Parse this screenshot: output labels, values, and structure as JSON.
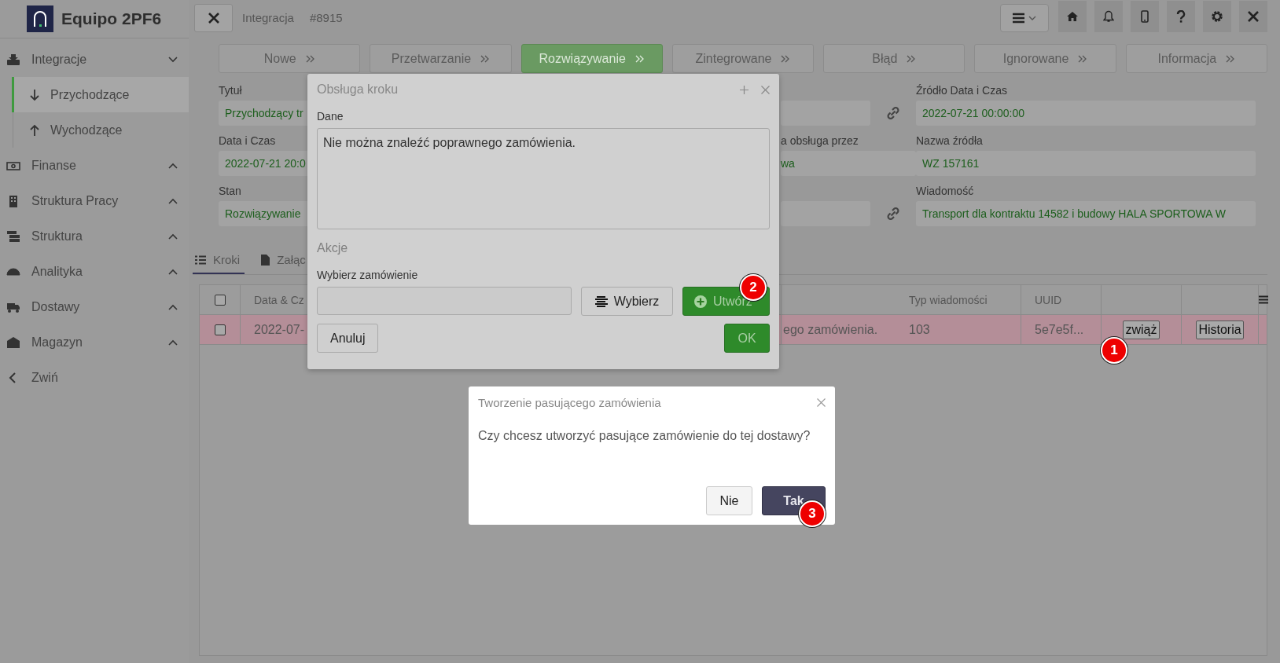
{
  "app": {
    "name": "Equipo 2PF6"
  },
  "sidebar": {
    "items": [
      {
        "label": "Integracje",
        "expanded": true,
        "children": [
          {
            "label": "Przychodzące",
            "selected": true
          },
          {
            "label": "Wychodzące",
            "selected": false
          }
        ]
      },
      {
        "label": "Finanse",
        "expanded": false
      },
      {
        "label": "Struktura Pracy",
        "expanded": false
      },
      {
        "label": "Struktura",
        "expanded": false
      },
      {
        "label": "Analityka",
        "expanded": false
      },
      {
        "label": "Dostawy",
        "expanded": false
      },
      {
        "label": "Magazyn",
        "expanded": false
      }
    ],
    "collapse": "Zwiń"
  },
  "topbar": {
    "title": "Integracja",
    "number": "#8915"
  },
  "status_steps": [
    {
      "label": "Nowe",
      "selected": false
    },
    {
      "label": "Przetwarzanie",
      "selected": false
    },
    {
      "label": "Rozwiązywanie",
      "selected": true
    },
    {
      "label": "Zintegrowane",
      "selected": false
    },
    {
      "label": "Błąd",
      "selected": false
    },
    {
      "label": "Ignorowane",
      "selected": false
    },
    {
      "label": "Informacja",
      "selected": false
    }
  ],
  "form": {
    "rows": [
      [
        {
          "label": "Tytuł",
          "value": "Przychodzący tr"
        },
        {},
        {
          "label": "Źródło Data i Czas",
          "value": "2022-07-21 00:00:00"
        }
      ],
      [
        {
          "label": "Data i Czas",
          "value": "2022-07-21 20:0"
        },
        {
          "label": "a obsługa przez",
          "value": "wa"
        },
        {
          "label": "Nazwa źródła",
          "value": "WZ 157161"
        }
      ],
      [
        {
          "label": "Stan",
          "value": "Rozwiązywanie"
        },
        {},
        {
          "label": "Wiadomość",
          "value": "Transport dla kontraktu 14582 i budowy HALA SPORTOWA W"
        }
      ]
    ]
  },
  "detail_tabs": [
    {
      "label": "Kroki",
      "selected": true
    },
    {
      "label": "Załąc",
      "selected": false
    }
  ],
  "table": {
    "select_all": {
      "checked": false
    },
    "columns": [
      {
        "label": "Data & Cz"
      },
      {},
      {
        "label": "Typ wiadomości"
      },
      {
        "label": "UUID"
      },
      {},
      {}
    ],
    "rows": [
      {
        "checked": false,
        "highlighted": true,
        "cells": [
          "2022-07-",
          "ego zamówienia.",
          "103",
          "5e7e5f..."
        ],
        "actions": [
          "zwiąż",
          "Historia"
        ]
      }
    ]
  },
  "step_dialog": {
    "title": "Obsługa kroku",
    "data_label": "Dane",
    "data_value": "Nie można znaleźć poprawnego zamówienia.",
    "actions_heading": "Akcje",
    "order_label": "Wybierz zamówienie",
    "choose_button": "Wybierz",
    "create_button": "Utwórz",
    "cancel_button": "Anuluj",
    "ok_button": "OK"
  },
  "confirm_dialog": {
    "title": "Tworzenie pasującego zamówienia",
    "message": "Czy chcesz utworzyć pasujące zamówienie do tej dostawy?",
    "buttons": [
      {
        "label": "Nie",
        "kind": "secondary"
      },
      {
        "label": "Tak",
        "kind": "primary"
      }
    ]
  },
  "markers": [
    {
      "label": "1"
    },
    {
      "label": "2"
    },
    {
      "label": "3"
    }
  ]
}
